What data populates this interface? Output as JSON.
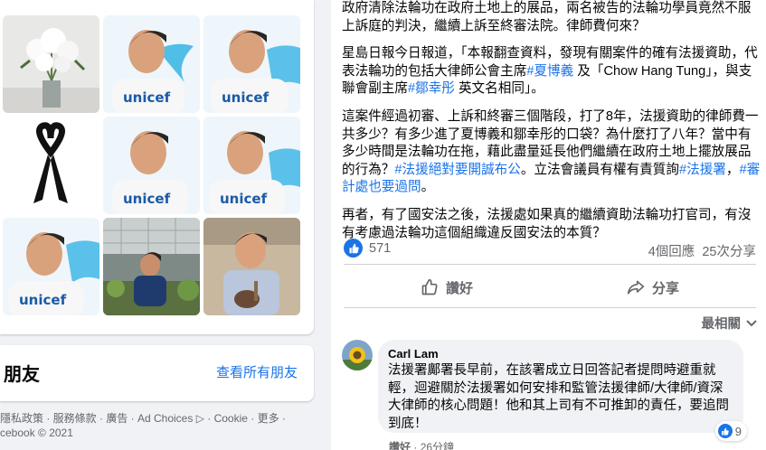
{
  "photos": [
    {
      "name": "white-flowers-photo"
    },
    {
      "name": "unicef-portrait-1"
    },
    {
      "name": "unicef-portrait-2"
    },
    {
      "name": "black-ribbon-photo"
    },
    {
      "name": "unicef-portrait-3"
    },
    {
      "name": "unicef-portrait-4"
    },
    {
      "name": "unicef-portrait-5"
    },
    {
      "name": "garden-photo"
    },
    {
      "name": "tea-cup-photo"
    }
  ],
  "unicef_text": "unicef",
  "friends": {
    "title": "朋友",
    "see_all": "查看所有朋友"
  },
  "footer": {
    "line1": "隱私政策 · 服務條款 · 廣告 · Ad Choices ▷ · Cookie · 更多 ·",
    "line2": "cebook © 2021"
  },
  "post": {
    "p1": "政府清除法輪功在政府土地上的展品，兩名被告的法輪功學員竟然不服上訴庭的判決，繼續上訴至終審法院。律師費何來？",
    "p2_a": "星島日報今日報道，「本報翻查資料，發現有關案件的確有法援資助，代表法輪功的包括大律師公會主席",
    "p2_tag1": "#夏博義",
    "p2_b": "及「Chow Hang Tung」，與支聯會副主席",
    "p2_tag2": "#鄒幸彤",
    "p2_c": "英文名相同」。",
    "p3_a": "這案件經過初審、上訴和終審三個階段，打了8年，法援資助的律師費一共多少？有多少進了夏博義和鄒幸彤的口袋？為什麼打了八年？當中有多少時間是法輪功在拖，藉此盡量延長他們繼續在政府土地上擺放展品的行為？",
    "p3_tag1": "#法援絕對要開誠布公",
    "p3_b": "。立法會議員有權有責質詢",
    "p3_tag2": "#法援署",
    "p3_c": "，",
    "p3_tag3": "#審計處也要過問",
    "p3_d": "。",
    "p4": "再者，有了國安法之後，法援處如果真的繼續資助法輪功打官司，有沒有考慮過法輪功這個組織違反國安法的本質？"
  },
  "stats": {
    "likes": "571",
    "comments": "4個回應",
    "shares": "25次分享"
  },
  "actions": {
    "like": "讚好",
    "share": "分享"
  },
  "sort_label": "最相關",
  "comment": {
    "author": "Carl Lam",
    "text": "法援署鄺署長早前，在該署成立日回答記者提問時避重就輕，迴避關於法援署如何安排和監管法援律師/大律師/資深大律師的核心問題！他和其上司有不可推卸的責任，要追問到底！",
    "reactions": "9",
    "like": "讚好",
    "time": "26分鐘"
  },
  "colors": {
    "link": "#1a73e8",
    "like_blue": "#1b74e4",
    "secondary_text": "#65676b"
  }
}
